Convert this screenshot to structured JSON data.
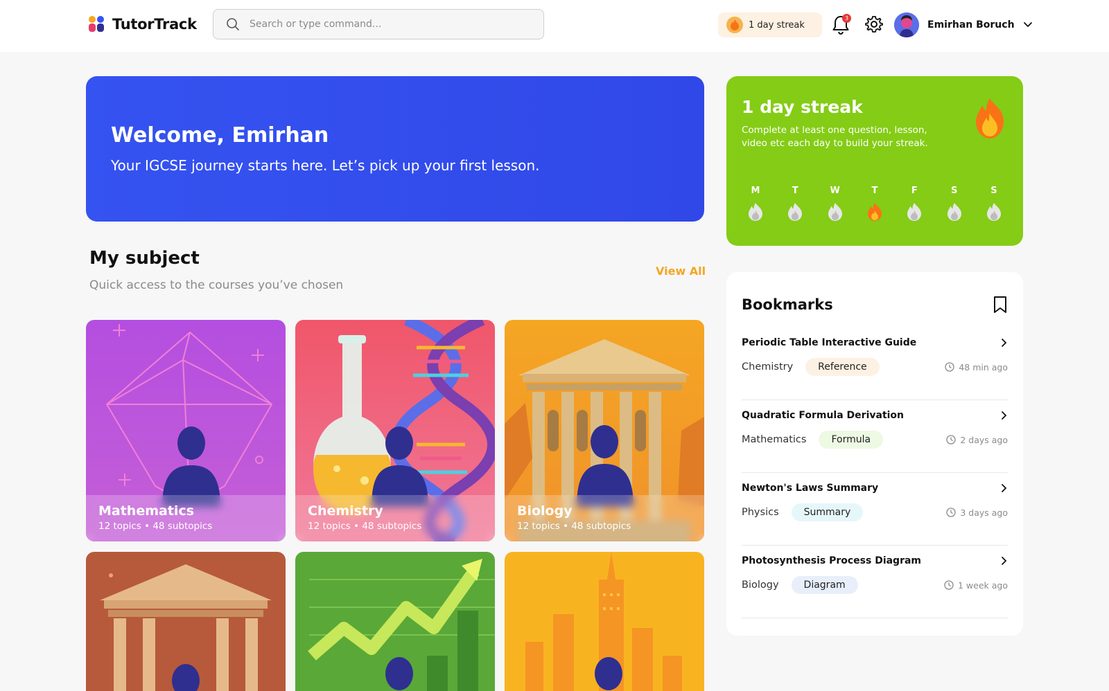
{
  "header": {
    "brand": "TutorTrack",
    "search_placeholder": "Search or type command...",
    "streak_label": "1 day streak",
    "notification_count": "3",
    "user_name": "Emirhan Boruch"
  },
  "welcome": {
    "title": "Welcome, Emirhan",
    "subtitle": "Your IGCSE journey starts here. Let’s pick up your first lesson."
  },
  "streak": {
    "title": "1 day streak",
    "description": "Complete at least one question, lesson, video etc each day to build your streak.",
    "days": [
      {
        "label": "M",
        "active": false
      },
      {
        "label": "T",
        "active": false
      },
      {
        "label": "W",
        "active": false
      },
      {
        "label": "T",
        "active": true
      },
      {
        "label": "F",
        "active": false
      },
      {
        "label": "S",
        "active": false
      },
      {
        "label": "S",
        "active": false
      }
    ]
  },
  "subjects": {
    "title": "My subject",
    "subtitle": "Quick access to the courses you’ve chosen",
    "view_all": "View All",
    "cards": [
      {
        "name": "Mathematics",
        "meta": "12 topics • 48 subtopics"
      },
      {
        "name": "Chemistry",
        "meta": "12 topics • 48 subtopics"
      },
      {
        "name": "Biology",
        "meta": "12 topics • 48 subtopics"
      },
      {
        "name": "",
        "meta": ""
      },
      {
        "name": "",
        "meta": ""
      },
      {
        "name": "",
        "meta": ""
      }
    ]
  },
  "bookmarks": {
    "title": "Bookmarks",
    "items": [
      {
        "title": "Periodic Table Interactive Guide",
        "subject": "Chemistry",
        "tag": "Reference",
        "tag_color": "#fdf1e3",
        "time": "48 min ago"
      },
      {
        "title": "Quadratic Formula Derivation",
        "subject": "Mathematics",
        "tag": "Formula",
        "tag_color": "#eef9e3",
        "time": "2 days ago"
      },
      {
        "title": "Newton's Laws Summary",
        "subject": "Physics",
        "tag": "Summary",
        "tag_color": "#e6f7fb",
        "time": "3 days ago"
      },
      {
        "title": "Photosynthesis Process Diagram",
        "subject": "Biology",
        "tag": "Diagram",
        "tag_color": "#e8effa",
        "time": "1 week ago"
      }
    ]
  },
  "colors": {
    "primary_blue": "#3553f0",
    "streak_green": "#84cc16",
    "accent_orange": "#f5a623"
  }
}
